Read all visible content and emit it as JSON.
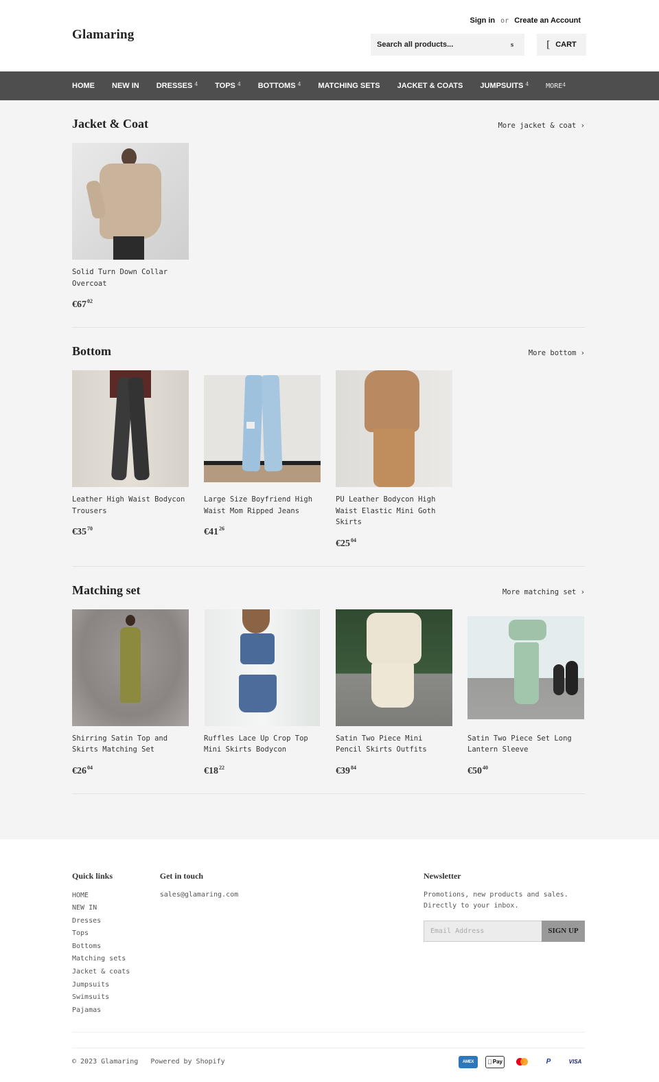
{
  "header": {
    "logo": "Glamaring",
    "sign_in": "Sign in",
    "or": "or",
    "create_account": "Create an Account",
    "search_placeholder": "Search all products...",
    "search_button": "s",
    "cart_icon": "[",
    "cart_label": "CART"
  },
  "nav": {
    "items": [
      {
        "label": "HOME",
        "caret": ""
      },
      {
        "label": "NEW IN",
        "caret": ""
      },
      {
        "label": "DRESSES",
        "caret": "4"
      },
      {
        "label": "TOPS",
        "caret": "4"
      },
      {
        "label": "BOTTOMS",
        "caret": "4"
      },
      {
        "label": "MATCHING SETS",
        "caret": ""
      },
      {
        "label": "JACKET & COATS",
        "caret": ""
      },
      {
        "label": "JUMPSUITS",
        "caret": "4"
      }
    ],
    "more": {
      "label": "MORE",
      "caret": "4"
    }
  },
  "collections": [
    {
      "title": "Jacket & Coat",
      "more_link": "More jacket & coat ›",
      "products": [
        {
          "title": "Solid Turn Down Collar Overcoat",
          "price_main": "€67",
          "price_cents": "02",
          "image": "beige-quilted-overcoat"
        }
      ]
    },
    {
      "title": "Bottom",
      "more_link": "More bottom ›",
      "products": [
        {
          "title": "Leather High Waist Bodycon Trousers",
          "price_main": "€35",
          "price_cents": "70",
          "image": "black-leather-trousers"
        },
        {
          "title": "Large Size Boyfriend High Waist Mom Ripped Jeans",
          "price_main": "€41",
          "price_cents": "26",
          "image": "light-blue-ripped-jeans"
        },
        {
          "title": "PU Leather Bodycon High Waist Elastic Mini Goth Skirts",
          "price_main": "€25",
          "price_cents": "04",
          "image": "tan-mini-skirt-satin-blouse"
        }
      ]
    },
    {
      "title": "Matching set",
      "more_link": "More matching set ›",
      "products": [
        {
          "title": "Shirring Satin Top and Skirts Matching Set",
          "price_main": "€26",
          "price_cents": "04",
          "image": "olive-satin-set"
        },
        {
          "title": "Ruffles Lace Up Crop Top Mini Skirts Bodycon",
          "price_main": "€18",
          "price_cents": "22",
          "image": "blue-floral-crop-set"
        },
        {
          "title": "Satin Two Piece Mini Pencil Skirts Outfits",
          "price_main": "€39",
          "price_cents": "84",
          "image": "cream-satin-two-piece"
        },
        {
          "title": "Satin Two Piece Set Long Lantern Sleeve",
          "price_main": "€50",
          "price_cents": "40",
          "image": "mint-satin-lantern-sleeve-set"
        }
      ]
    }
  ],
  "footer": {
    "quick_links_title": "Quick links",
    "quick_links": [
      "HOME",
      "NEW IN",
      "Dresses",
      "Tops",
      "Bottoms",
      "Matching sets",
      "Jacket & coats",
      "Jumpsuits",
      "Swimsuits",
      "Pajamas"
    ],
    "contact_title": "Get in touch",
    "email": "sales@glamaring.com",
    "newsletter_title": "Newsletter",
    "newsletter_text": "Promotions, new products and sales. Directly to your inbox.",
    "email_placeholder": "Email Address",
    "signup_label": "SIGN UP",
    "copyright": "© 2023 Glamaring",
    "powered_by": "Powered by Shopify",
    "payments": [
      {
        "name": "amex",
        "label": "AMEX"
      },
      {
        "name": "apple-pay",
        "label": "Pay"
      },
      {
        "name": "mastercard",
        "label": ""
      },
      {
        "name": "paypal",
        "label": "P"
      },
      {
        "name": "visa",
        "label": "VISA"
      }
    ]
  }
}
